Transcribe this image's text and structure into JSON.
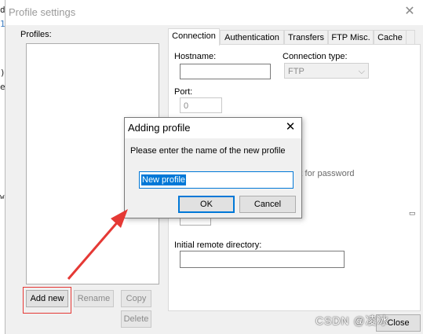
{
  "left_strip": [
    "d",
    "1",
    ")",
    "e",
    "w"
  ],
  "window": {
    "title": "Profile settings",
    "close_glyph": "✕"
  },
  "profiles": {
    "label": "Profiles:",
    "buttons": {
      "add_new": "Add new",
      "rename": "Rename",
      "copy": "Copy",
      "delete": "Delete"
    }
  },
  "tabs": [
    "Connection",
    "Authentication",
    "Transfers",
    "FTP Misc.",
    "Cache"
  ],
  "connection": {
    "hostname_label": "Hostname:",
    "hostname_value": "",
    "connection_type_label": "Connection type:",
    "connection_type_value": "FTP",
    "port_label": "Port:",
    "port_value": "0",
    "ask_password_partial": "k for password",
    "initial_dir_label": "Initial remote directory:",
    "initial_dir_value": ""
  },
  "dialog": {
    "title": "Adding profile",
    "close_glyph": "✕",
    "prompt": "Please enter the name of the new profile",
    "input_value": "New profile",
    "ok": "OK",
    "cancel": "Cancel"
  },
  "footer": {
    "close_partial": "Close"
  },
  "watermark": "CSDN @凌冰",
  "colors": {
    "accent": "#0078d7",
    "annotation": "#e53935"
  }
}
